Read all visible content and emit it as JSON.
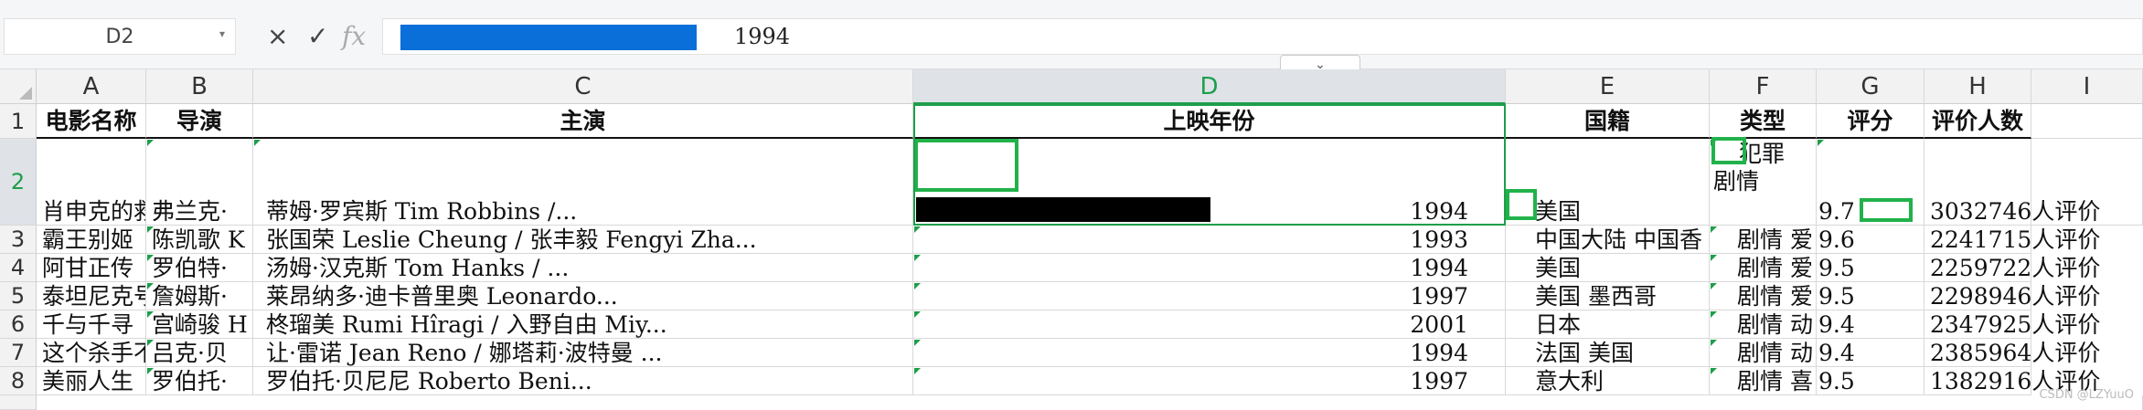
{
  "formula_bar": {
    "name_box": "D2",
    "cancel_glyph": "×",
    "confirm_glyph": "✓",
    "fx_label": "fx",
    "value": "1994"
  },
  "columns": [
    "A",
    "B",
    "C",
    "D",
    "E",
    "F",
    "G",
    "H",
    "I"
  ],
  "rows": [
    "1",
    "2",
    "3",
    "4",
    "5",
    "6",
    "7",
    "8"
  ],
  "header_row": {
    "A": "电影名称",
    "B": "导演",
    "C": "主演",
    "D": "上映年份",
    "E": "国籍",
    "F": "类型",
    "G": "评分",
    "H": "评价人数"
  },
  "records": [
    {
      "name": "肖申克的救",
      "director": "弗兰克·",
      "cast": "蒂姆·罗宾斯 Tim Robbins /...",
      "year": "1994",
      "country": "美国",
      "genre_line1": "犯罪",
      "genre_line2": "剧情",
      "score": "9.7",
      "votes": "3032746人评价"
    },
    {
      "name": "霸王别姬",
      "director": "陈凯歌 K",
      "cast": "张国荣 Leslie Cheung / 张丰毅 Fengyi Zha...",
      "year": "1993",
      "country": "中国大陆 中国香",
      "genre": "剧情 爱",
      "score": "9.6",
      "votes": "2241715人评价"
    },
    {
      "name": "阿甘正传",
      "director": "罗伯特·",
      "cast": "汤姆·汉克斯 Tom Hanks / ...",
      "year": "1994",
      "country": "美国",
      "genre": "剧情 爱",
      "score": "9.5",
      "votes": "2259722人评价"
    },
    {
      "name": "泰坦尼克号",
      "director": "詹姆斯·",
      "cast": "莱昂纳多·迪卡普里奥 Leonardo...",
      "year": "1997",
      "country": "美国 墨西哥",
      "genre": "剧情 爱",
      "score": "9.5",
      "votes": "2298946人评价"
    },
    {
      "name": "千与千寻",
      "director": "宫崎骏 H",
      "cast": "柊瑠美 Rumi Hîragi / 入野自由 Miy...",
      "year": "2001",
      "country": "日本",
      "genre": "剧情 动",
      "score": "9.4",
      "votes": "2347925人评价"
    },
    {
      "name": "这个杀手不",
      "director": "吕克·贝",
      "cast": "让·雷诺 Jean Reno / 娜塔莉·波特曼 ...",
      "year": "1994",
      "country": "法国 美国",
      "genre": "剧情 动",
      "score": "9.4",
      "votes": "2385964人评价"
    },
    {
      "name": "美丽人生",
      "director": "罗伯托·",
      "cast": "罗伯托·贝尼尼 Roberto Beni...",
      "year": "1997",
      "country": "意大利",
      "genre": "剧情 喜",
      "score": "9.5",
      "votes": "1382916人评价"
    }
  ],
  "watermark": "CSDN @LZYuuO"
}
